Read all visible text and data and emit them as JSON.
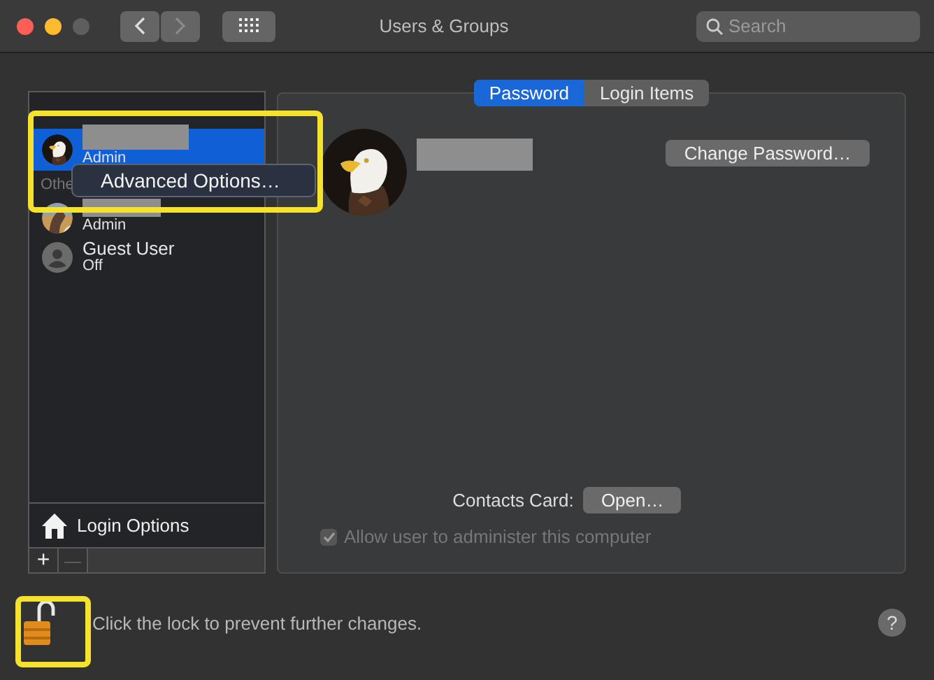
{
  "window": {
    "title": "Users & Groups",
    "search_placeholder": "Search"
  },
  "users": [
    {
      "kind": "account",
      "selected": true,
      "role": "Admin"
    },
    {
      "kind": "account",
      "selected": false,
      "role": "Admin"
    },
    {
      "kind": "guest",
      "selected": false,
      "name": "Guest User",
      "role": "Off"
    }
  ],
  "section_label": "Othe",
  "context_menu": {
    "items": [
      "Advanced Options…"
    ]
  },
  "login_options": "Login Options",
  "list_buttons": [
    {
      "label": "+",
      "disabled": false
    },
    {
      "label": "—",
      "disabled": true
    }
  ],
  "tabs": [
    {
      "label": "Password",
      "selected": true
    },
    {
      "label": "Login Items",
      "selected": false
    }
  ],
  "change_password": "Change Password…",
  "contacts_label": "Contacts Card:",
  "open_button": "Open…",
  "admin_checkbox": {
    "label": "Allow user to administer this computer",
    "checked": true,
    "disabled": true
  },
  "lock": {
    "locked": false,
    "message": "Click the lock to prevent further changes."
  },
  "help": "?"
}
